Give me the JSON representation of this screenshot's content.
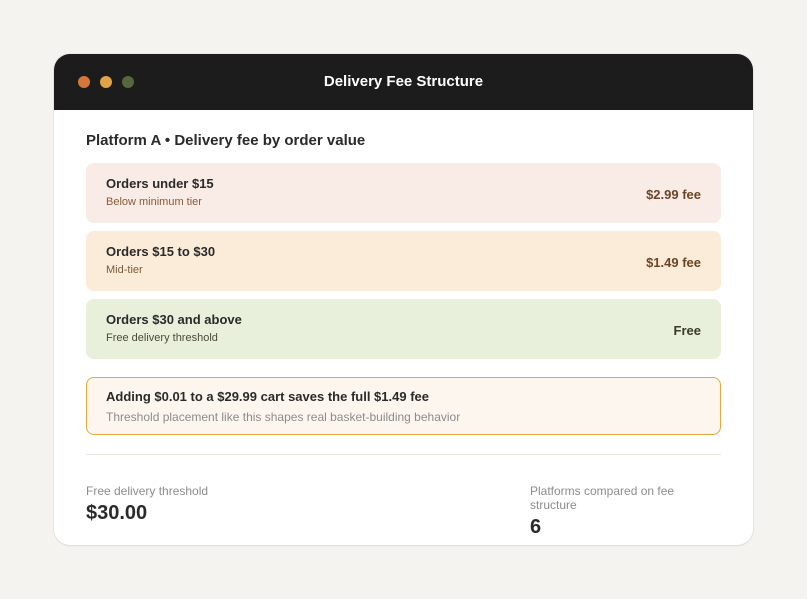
{
  "window": {
    "title": "Delivery Fee Structure"
  },
  "section": {
    "heading": "Platform A • Delivery fee by order value"
  },
  "tiers": [
    {
      "name": "Orders under $15",
      "description": "Below minimum tier",
      "fee": "$2.99 fee",
      "bg_color": "#f9ebe6",
      "desc_color": "#8a5a3a",
      "fee_color": "#6b4526"
    },
    {
      "name": "Orders $15 to $30",
      "description": "Mid-tier",
      "fee": "$1.49 fee",
      "bg_color": "#fbecda",
      "desc_color": "#7a5a3a",
      "fee_color": "#6b4526"
    },
    {
      "name": "Orders $30 and above",
      "description": "Free delivery threshold",
      "fee": "Free",
      "bg_color": "#e8f0dc",
      "desc_color": "#4a4a3a",
      "fee_color": "#3a3a2a"
    }
  ],
  "callout": {
    "title": "Adding $0.01 to a $29.99 cart saves the full $1.49 fee",
    "subtitle": "Threshold placement like this shapes real basket-building behavior",
    "border_color": "#e0aa40"
  },
  "stats": {
    "threshold_label": "Free delivery threshold",
    "threshold_value": "$30.00",
    "platforms_label": "Platforms compared on fee structure",
    "platforms_value": "6"
  },
  "colors": {
    "titlebar": "#1c1c1c",
    "dot_red": "#d7763a",
    "dot_yellow": "#e0a246",
    "dot_green": "#55673d"
  }
}
